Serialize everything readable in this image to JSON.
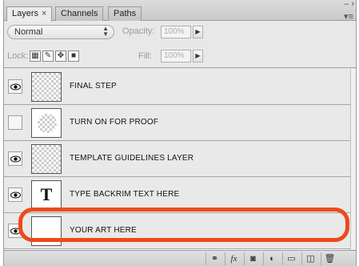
{
  "tabs": [
    {
      "label": "Layers",
      "close": "×"
    },
    {
      "label": "Channels"
    },
    {
      "label": "Paths"
    }
  ],
  "window_controls": {
    "collapse": "– ›",
    "menu": "▾≡"
  },
  "blend_mode": {
    "value": "Normal"
  },
  "opacity": {
    "label": "Opacity:",
    "value": "100%"
  },
  "lock": {
    "label": "Lock:"
  },
  "fill": {
    "label": "Fill:",
    "value": "100%"
  },
  "layers": [
    {
      "name": "FINAL STEP",
      "visible": true,
      "thumb": "checker-circle"
    },
    {
      "name": "TURN ON FOR PROOF",
      "visible": false,
      "thumb": "checker-circle"
    },
    {
      "name": "TEMPLATE GUIDELINES LAYER",
      "visible": true,
      "thumb": "checker"
    },
    {
      "name": "TYPE BACKRIM TEXT HERE",
      "visible": true,
      "thumb": "type",
      "thumb_glyph": "T"
    },
    {
      "name": "YOUR ART HERE",
      "visible": true,
      "thumb": "white"
    }
  ],
  "bottom_icons": [
    "link-icon",
    "fx-icon",
    "mask-icon",
    "adjustment-icon",
    "group-folder-icon",
    "new-layer-icon",
    "trash-icon"
  ],
  "bottom_labels": {
    "fx": "fx"
  },
  "colors": {
    "highlight": "#ee4a1a"
  }
}
